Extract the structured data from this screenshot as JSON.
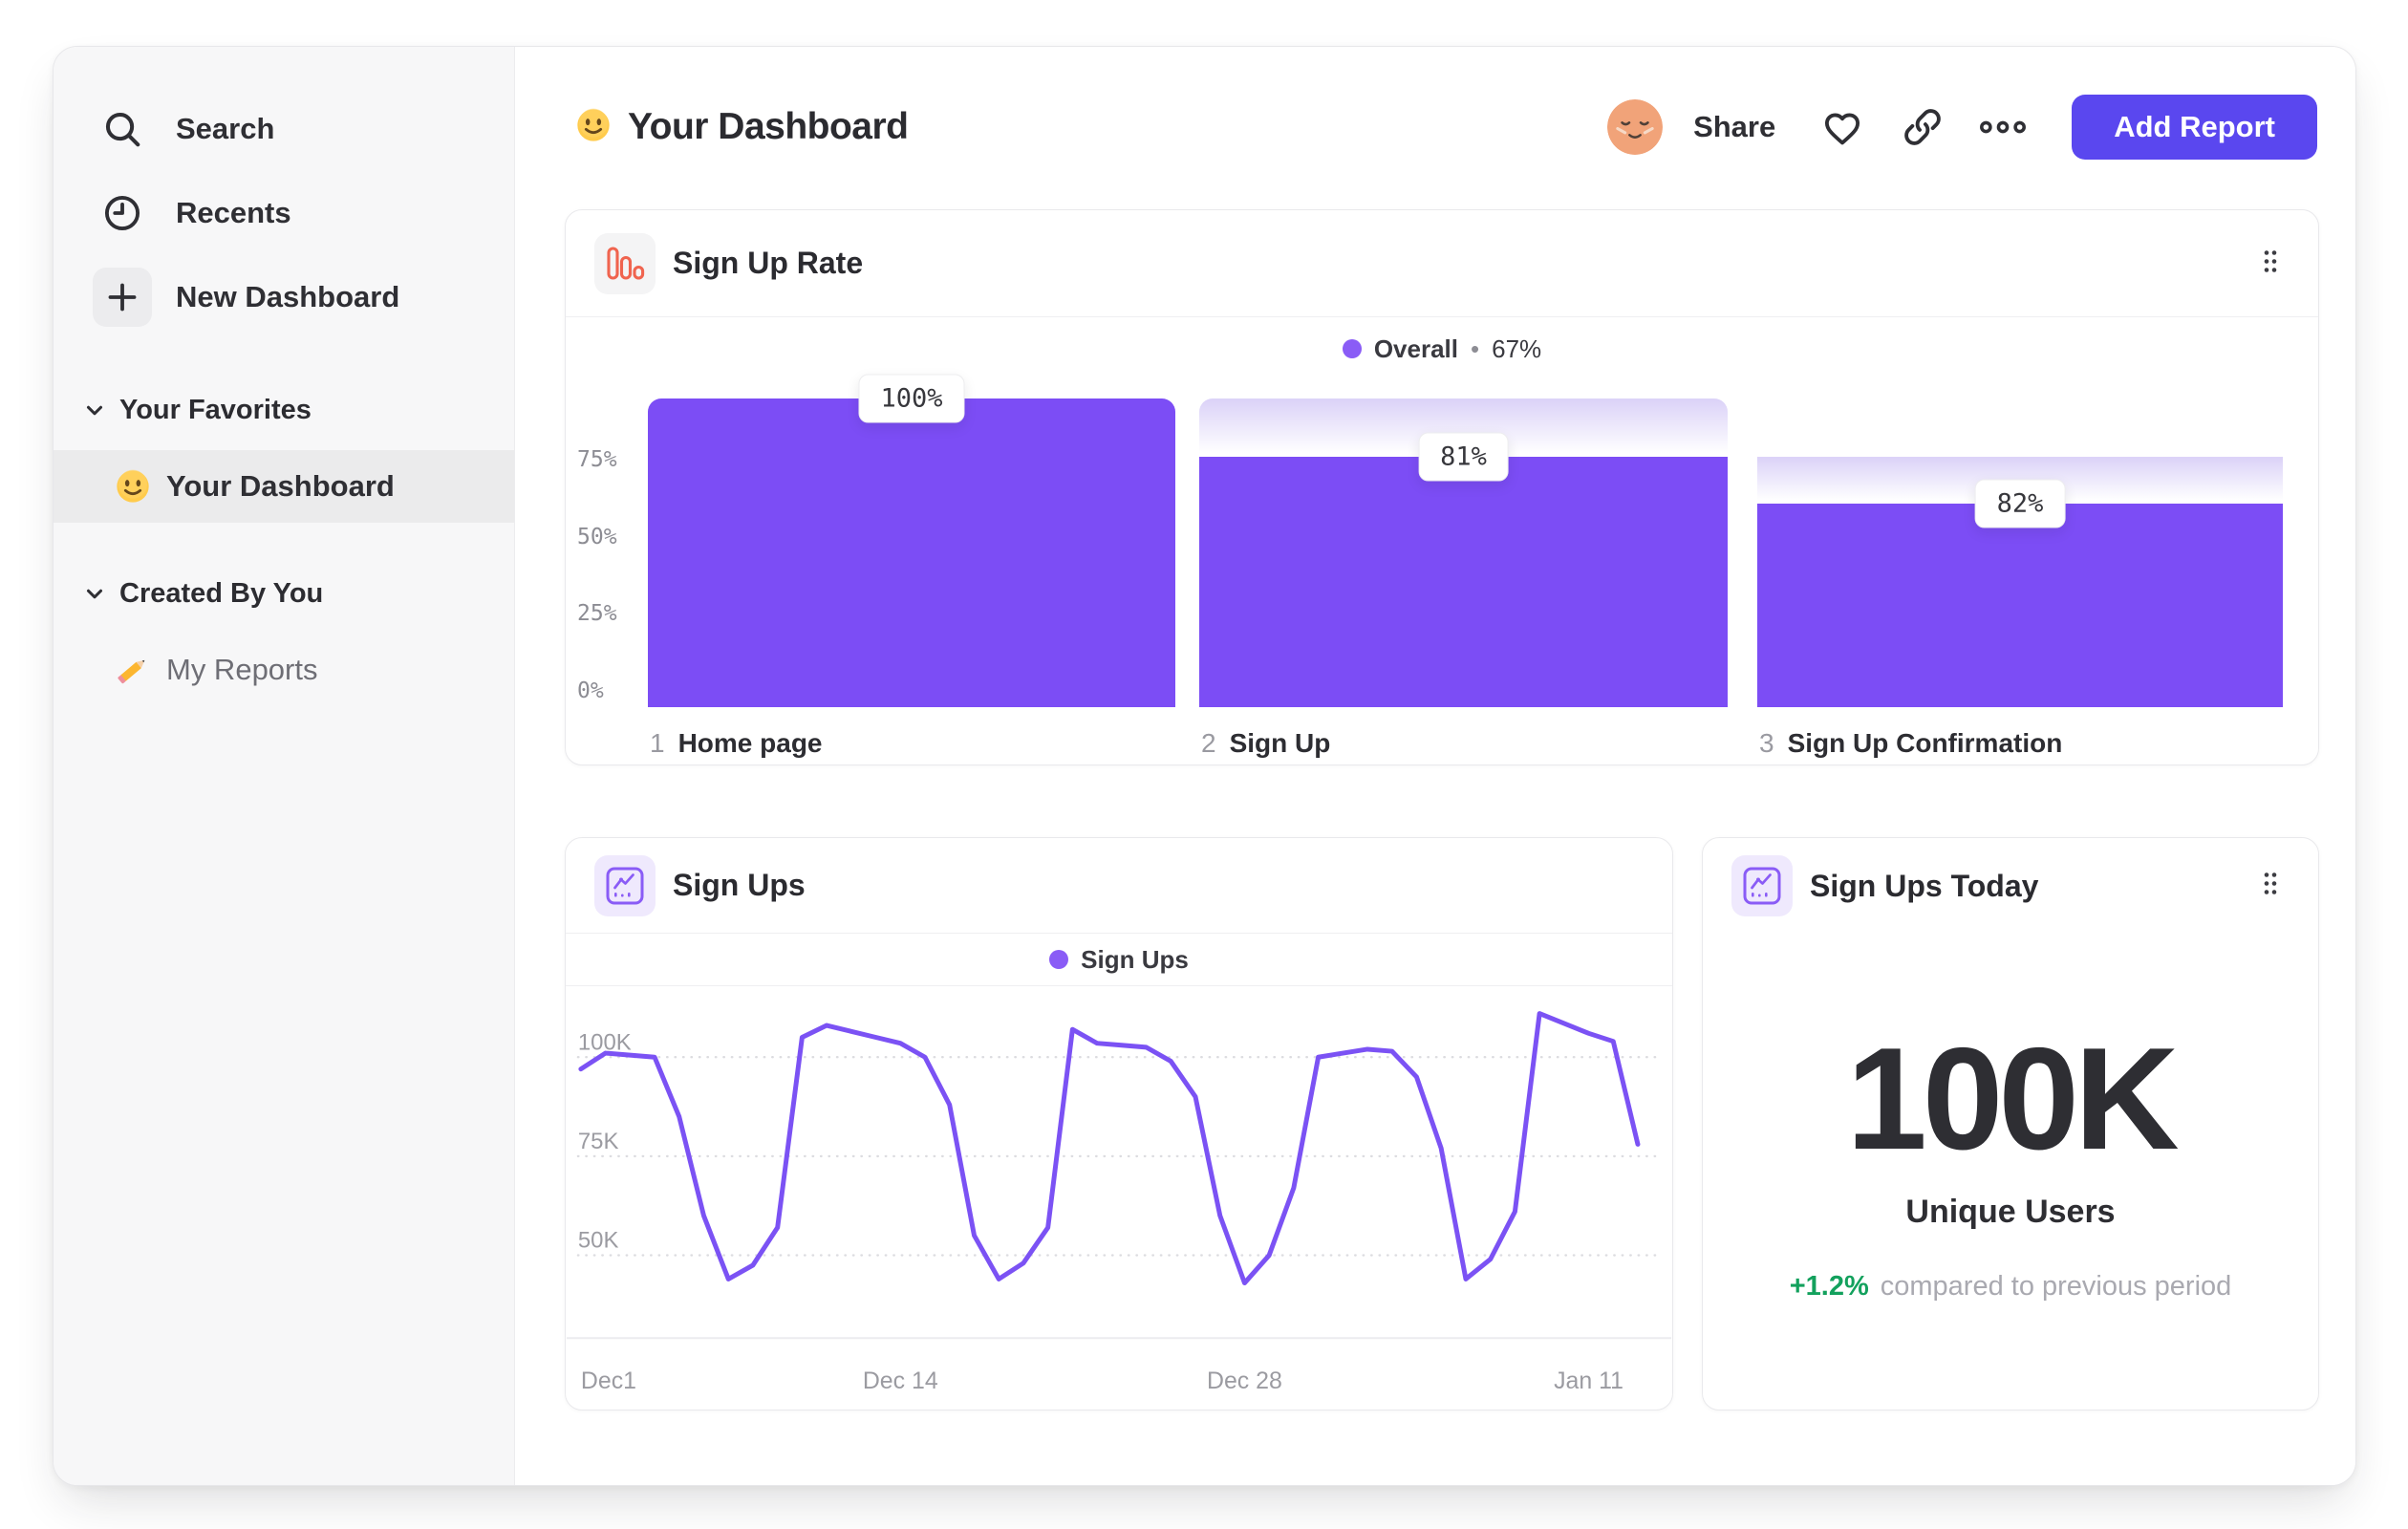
{
  "sidebar": {
    "nav": [
      {
        "id": "search",
        "label": "Search",
        "icon": "search-icon",
        "boxed": false
      },
      {
        "id": "recents",
        "label": "Recents",
        "icon": "clock-icon",
        "boxed": false
      },
      {
        "id": "new-dashboard",
        "label": "New Dashboard",
        "icon": "plus-icon",
        "boxed": true
      }
    ],
    "sections": [
      {
        "id": "your-favorites",
        "label": "Your Favorites",
        "items": [
          {
            "id": "your-dashboard",
            "label": "Your Dashboard",
            "icon": "smiley-emoji",
            "active": true
          }
        ]
      },
      {
        "id": "created-by-you",
        "label": "Created By You",
        "items": [
          {
            "id": "my-reports",
            "label": "My Reports",
            "icon": "pencil-emoji",
            "active": false,
            "dim": true
          }
        ]
      }
    ]
  },
  "header": {
    "title": "Your Dashboard",
    "title_emoji": "smiley-emoji",
    "share_label": "Share",
    "add_report_label": "Add Report",
    "action_icons": [
      "avatar",
      "heart-icon",
      "link-icon",
      "more-options-icon"
    ]
  },
  "cards": {
    "funnel": {
      "title": "Sign Up Rate",
      "icon": "funnel-chart-icon",
      "legend_name": "Overall",
      "legend_separator": "•",
      "legend_value": "67%"
    },
    "line": {
      "title": "Sign Ups",
      "icon": "line-chart-icon",
      "legend_name": "Sign Ups"
    },
    "kpi": {
      "title": "Sign Ups Today",
      "icon": "line-chart-icon",
      "value": "100K",
      "label": "Unique Users",
      "delta": "+1.2%",
      "delta_note": "compared to previous period"
    }
  },
  "chart_data": [
    {
      "type": "bar",
      "variant": "funnel",
      "title": "Sign Up Rate",
      "legend": "Overall • 67%",
      "overall_conversion_pct": 67,
      "y_ticks": [
        {
          "label": "75%",
          "value": 75
        },
        {
          "label": "50%",
          "value": 50
        },
        {
          "label": "25%",
          "value": 25
        },
        {
          "label": "0%",
          "value": 0
        }
      ],
      "steps": [
        {
          "step": 1,
          "label": "Home page",
          "step_conversion_label": "100%",
          "overall_pct": 100,
          "prev_overall_pct": 100
        },
        {
          "step": 2,
          "label": "Sign Up",
          "step_conversion_label": "81%",
          "overall_pct": 81,
          "prev_overall_pct": 100
        },
        {
          "step": 3,
          "label": "Sign Up Confirmation",
          "step_conversion_label": "82%",
          "overall_pct": 66,
          "prev_overall_pct": 81
        }
      ]
    },
    {
      "type": "line",
      "title": "Sign Ups",
      "legend_entries": [
        "Sign Ups"
      ],
      "grid": "dashed-horizontal",
      "y_ticks": [
        {
          "label": "100K",
          "value": 100
        },
        {
          "label": "75K",
          "value": 75
        },
        {
          "label": "50K",
          "value": 50
        }
      ],
      "x_ticks": [
        {
          "label": "Dec1",
          "day": 1
        },
        {
          "label": "Dec 14",
          "day": 14
        },
        {
          "label": "Dec 28",
          "day": 28
        },
        {
          "label": "Jan 11",
          "day": 42
        }
      ],
      "series": [
        {
          "name": "Sign Ups",
          "color": "#7b52f4",
          "unit": "thousands",
          "values": [
            97,
            101,
            100.5,
            100,
            85,
            60,
            44,
            47.5,
            57,
            105,
            108,
            106.5,
            105,
            103.5,
            100,
            88,
            55,
            44,
            48,
            57,
            107,
            103.5,
            103,
            102.5,
            99,
            90,
            60,
            43,
            50,
            67,
            100,
            101,
            102,
            101.5,
            95,
            77,
            44,
            49,
            61,
            111,
            108.5,
            106,
            104,
            78
          ]
        }
      ]
    },
    {
      "type": "kpi",
      "title": "Sign Ups Today",
      "value": "100K",
      "metric": "Unique Users",
      "change_pct": "+1.2%",
      "comparison": "compared to previous period"
    }
  ],
  "colors": {
    "accent_purple": "#7c4df5",
    "legend_purple": "#8a5cf6",
    "line_purple": "#7b52f4",
    "drop_gradient_top": "#dcd3f8",
    "button_indigo": "#5a47ef",
    "funnel_icon_orange": "#f0644f",
    "positive_green": "#13a15d",
    "sidebar_bg": "#f7f7f8",
    "grid_grey": "#dcdce0"
  }
}
